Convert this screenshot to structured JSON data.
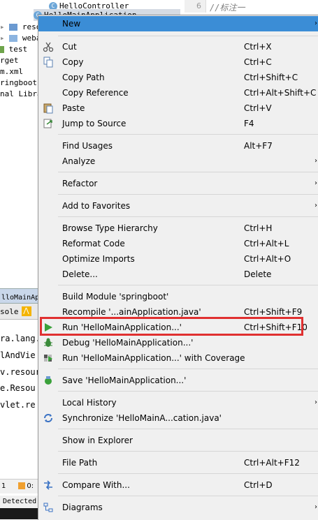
{
  "ide": {
    "tree": [
      {
        "text": "HelloController",
        "indent": 84
      },
      {
        "text": "HelloMainApplication",
        "indent": 60
      },
      {
        "text": "resou",
        "indent": 28
      },
      {
        "text": "webap",
        "indent": 28
      },
      {
        "text": "test",
        "indent": 8
      },
      {
        "text": "rget",
        "indent": 0
      },
      {
        "text": "m.xml",
        "indent": 0
      },
      {
        "text": "ringboot.",
        "indent": 0
      },
      {
        "text": "nal Libra",
        "indent": 0
      }
    ],
    "line_number": "6",
    "editor_comment": "//标注一",
    "run_tab": "lloMainAppl",
    "console_tab": "sole",
    "console_lines": [
      "ra.lang.",
      "lAndVie",
      "v.resour",
      "e.Resou",
      "vlet.re"
    ],
    "status_items": [
      "1",
      "0:"
    ],
    "status_text": "Detected"
  },
  "menu": {
    "items": [
      {
        "label": "New",
        "shortcut": "",
        "icon": "",
        "submenu": true,
        "highlighted": true
      },
      {
        "label": "Cut",
        "shortcut": "Ctrl+X",
        "icon": "scissors-icon"
      },
      {
        "label": "Copy",
        "shortcut": "Ctrl+C",
        "icon": "copy-icon"
      },
      {
        "label": "Copy Path",
        "shortcut": "Ctrl+Shift+C",
        "icon": ""
      },
      {
        "label": "Copy Reference",
        "shortcut": "Ctrl+Alt+Shift+C",
        "icon": ""
      },
      {
        "label": "Paste",
        "shortcut": "Ctrl+V",
        "icon": "paste-icon"
      },
      {
        "label": "Jump to Source",
        "shortcut": "F4",
        "icon": "jump-to-source-icon"
      },
      {
        "label": "Find Usages",
        "shortcut": "Alt+F7",
        "icon": ""
      },
      {
        "label": "Analyze",
        "shortcut": "",
        "icon": "",
        "submenu": true
      },
      {
        "label": "Refactor",
        "shortcut": "",
        "icon": "",
        "submenu": true
      },
      {
        "label": "Add to Favorites",
        "shortcut": "",
        "icon": "",
        "submenu": true
      },
      {
        "label": "Browse Type Hierarchy",
        "shortcut": "Ctrl+H",
        "icon": ""
      },
      {
        "label": "Reformat Code",
        "shortcut": "Ctrl+Alt+L",
        "icon": ""
      },
      {
        "label": "Optimize Imports",
        "shortcut": "Ctrl+Alt+O",
        "icon": ""
      },
      {
        "label": "Delete...",
        "shortcut": "Delete",
        "icon": ""
      },
      {
        "label": "Build Module 'springboot'",
        "shortcut": "",
        "icon": ""
      },
      {
        "label": "Recompile '...ainApplication.java'",
        "shortcut": "Ctrl+Shift+F9",
        "icon": ""
      },
      {
        "label": "Run 'HelloMainApplication...'",
        "shortcut": "Ctrl+Shift+F10",
        "icon": "run-icon"
      },
      {
        "label": "Debug 'HelloMainApplication...'",
        "shortcut": "",
        "icon": "debug-icon"
      },
      {
        "label": "Run 'HelloMainApplication...' with Coverage",
        "shortcut": "",
        "icon": "coverage-icon"
      },
      {
        "label": "Save 'HelloMainApplication...'",
        "shortcut": "",
        "icon": "save-config-icon"
      },
      {
        "label": "Local History",
        "shortcut": "",
        "icon": "",
        "submenu": true
      },
      {
        "label": "Synchronize 'HelloMainA...cation.java'",
        "shortcut": "",
        "icon": "sync-icon"
      },
      {
        "label": "Show in Explorer",
        "shortcut": "",
        "icon": ""
      },
      {
        "label": "File Path",
        "shortcut": "Ctrl+Alt+F12",
        "icon": ""
      },
      {
        "label": "Compare With...",
        "shortcut": "Ctrl+D",
        "icon": "compare-icon"
      },
      {
        "label": "Diagrams",
        "shortcut": "",
        "icon": "diagram-icon",
        "submenu": true
      }
    ],
    "highlight_color": "#3b8dd6",
    "callout_color": "#e03030"
  }
}
